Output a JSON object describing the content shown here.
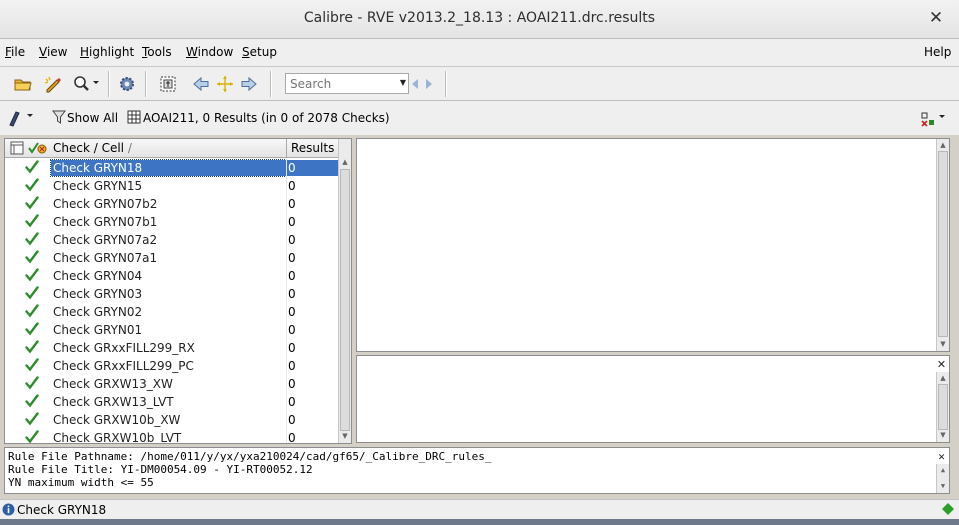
{
  "window": {
    "title": "Calibre - RVE v2013.2_18.13 : AOAI211.drc.results"
  },
  "menus": [
    {
      "label": "File",
      "mnemonic": "F",
      "rest": "ile"
    },
    {
      "label": "View",
      "mnemonic": "V",
      "rest": "iew"
    },
    {
      "label": "Highlight",
      "mnemonic": "H",
      "rest": "ighlight"
    },
    {
      "label": "Tools",
      "mnemonic": "T",
      "rest": "ools"
    },
    {
      "label": "Window",
      "mnemonic": "W",
      "rest": "indow"
    },
    {
      "label": "Setup",
      "mnemonic": "S",
      "rest": "etup"
    },
    {
      "label": "Help",
      "mnemonic": "",
      "rest": "Help"
    }
  ],
  "toolbar": {
    "search_placeholder": "Search"
  },
  "subbar": {
    "show_all_label": "Show All",
    "db_summary": "AOAI211, 0 Results (in 0 of 2078 Checks)"
  },
  "tree": {
    "col_check": "Check / Cell",
    "col_results": "Results",
    "rows": [
      {
        "name": "Check GRYN18",
        "results": "0",
        "selected": true
      },
      {
        "name": "Check GRYN15",
        "results": "0"
      },
      {
        "name": "Check GRYN07b2",
        "results": "0"
      },
      {
        "name": "Check GRYN07b1",
        "results": "0"
      },
      {
        "name": "Check GRYN07a2",
        "results": "0"
      },
      {
        "name": "Check GRYN07a1",
        "results": "0"
      },
      {
        "name": "Check GRYN04",
        "results": "0"
      },
      {
        "name": "Check GRYN03",
        "results": "0"
      },
      {
        "name": "Check GRYN02",
        "results": "0"
      },
      {
        "name": "Check GRYN01",
        "results": "0"
      },
      {
        "name": "Check GRxxFILL299_RX",
        "results": "0"
      },
      {
        "name": "Check GRxxFILL299_PC",
        "results": "0"
      },
      {
        "name": "Check GRXW13_XW",
        "results": "0"
      },
      {
        "name": "Check GRXW13_LVT",
        "results": "0"
      },
      {
        "name": "Check GRXW10b_XW",
        "results": "0"
      },
      {
        "name": "Check GRXW10b_LVT",
        "results": "0"
      }
    ]
  },
  "info": {
    "line1": "Rule File Pathname: /home/011/y/yx/yxa210024/cad/gf65/_Calibre_DRC_rules_",
    "line2": "Rule File Title: YI-DM00054.09 - YI-RT00052.12",
    "line3": "YN maximum width <= 55"
  },
  "status": {
    "text": "Check GRYN18"
  },
  "colors": {
    "selection": "#3e74c4",
    "check_green": "#2e8b2e",
    "status_ok": "#2aa02a"
  }
}
